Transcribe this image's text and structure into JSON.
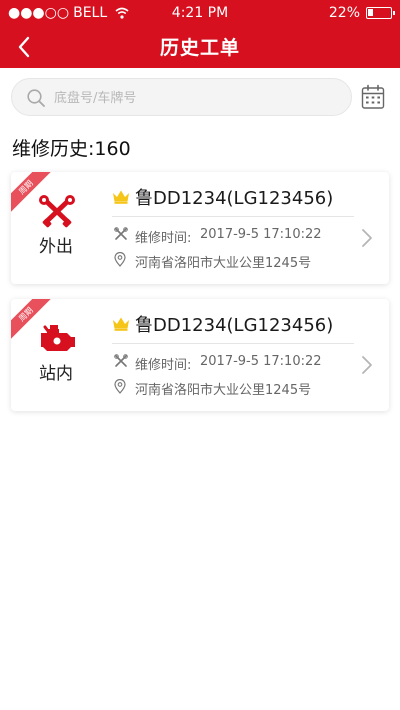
{
  "status_bar": {
    "signal": "●●●○○",
    "carrier": "BELL",
    "time": "4:21 PM",
    "battery": "22%",
    "battery_level": 0.22
  },
  "nav": {
    "title": "历史工单"
  },
  "search": {
    "placeholder": "底盘号/车牌号",
    "value": ""
  },
  "history": {
    "title": "维修历史:160"
  },
  "records": [
    {
      "badge": "周期",
      "type": "外出",
      "plate": "鲁DD1234(LG123456)",
      "time_label": "维修时间:",
      "time_value": "2017-9-5  17:10:22",
      "address": "河南省洛阳市大业公里1245号"
    },
    {
      "badge": "周期",
      "type": "站内",
      "plate": "鲁DD1234(LG123456)",
      "time_label": "维修时间:",
      "time_value": "2017-9-5  17:10:22",
      "address": "河南省洛阳市大业公里1245号"
    }
  ],
  "colors": {
    "brand_red": "#d7101f",
    "badge_red": "#e8505b",
    "crown_gold": "#f5c518"
  },
  "icons": {
    "back": "chevron-left-icon",
    "search": "search-icon",
    "calendar": "calendar-icon",
    "outside_type": "crossed-tools-icon",
    "inside_type": "engine-icon",
    "vip": "crown-icon",
    "time": "wrench-icon",
    "location": "location-pin-icon",
    "more": "chevron-right-icon"
  }
}
